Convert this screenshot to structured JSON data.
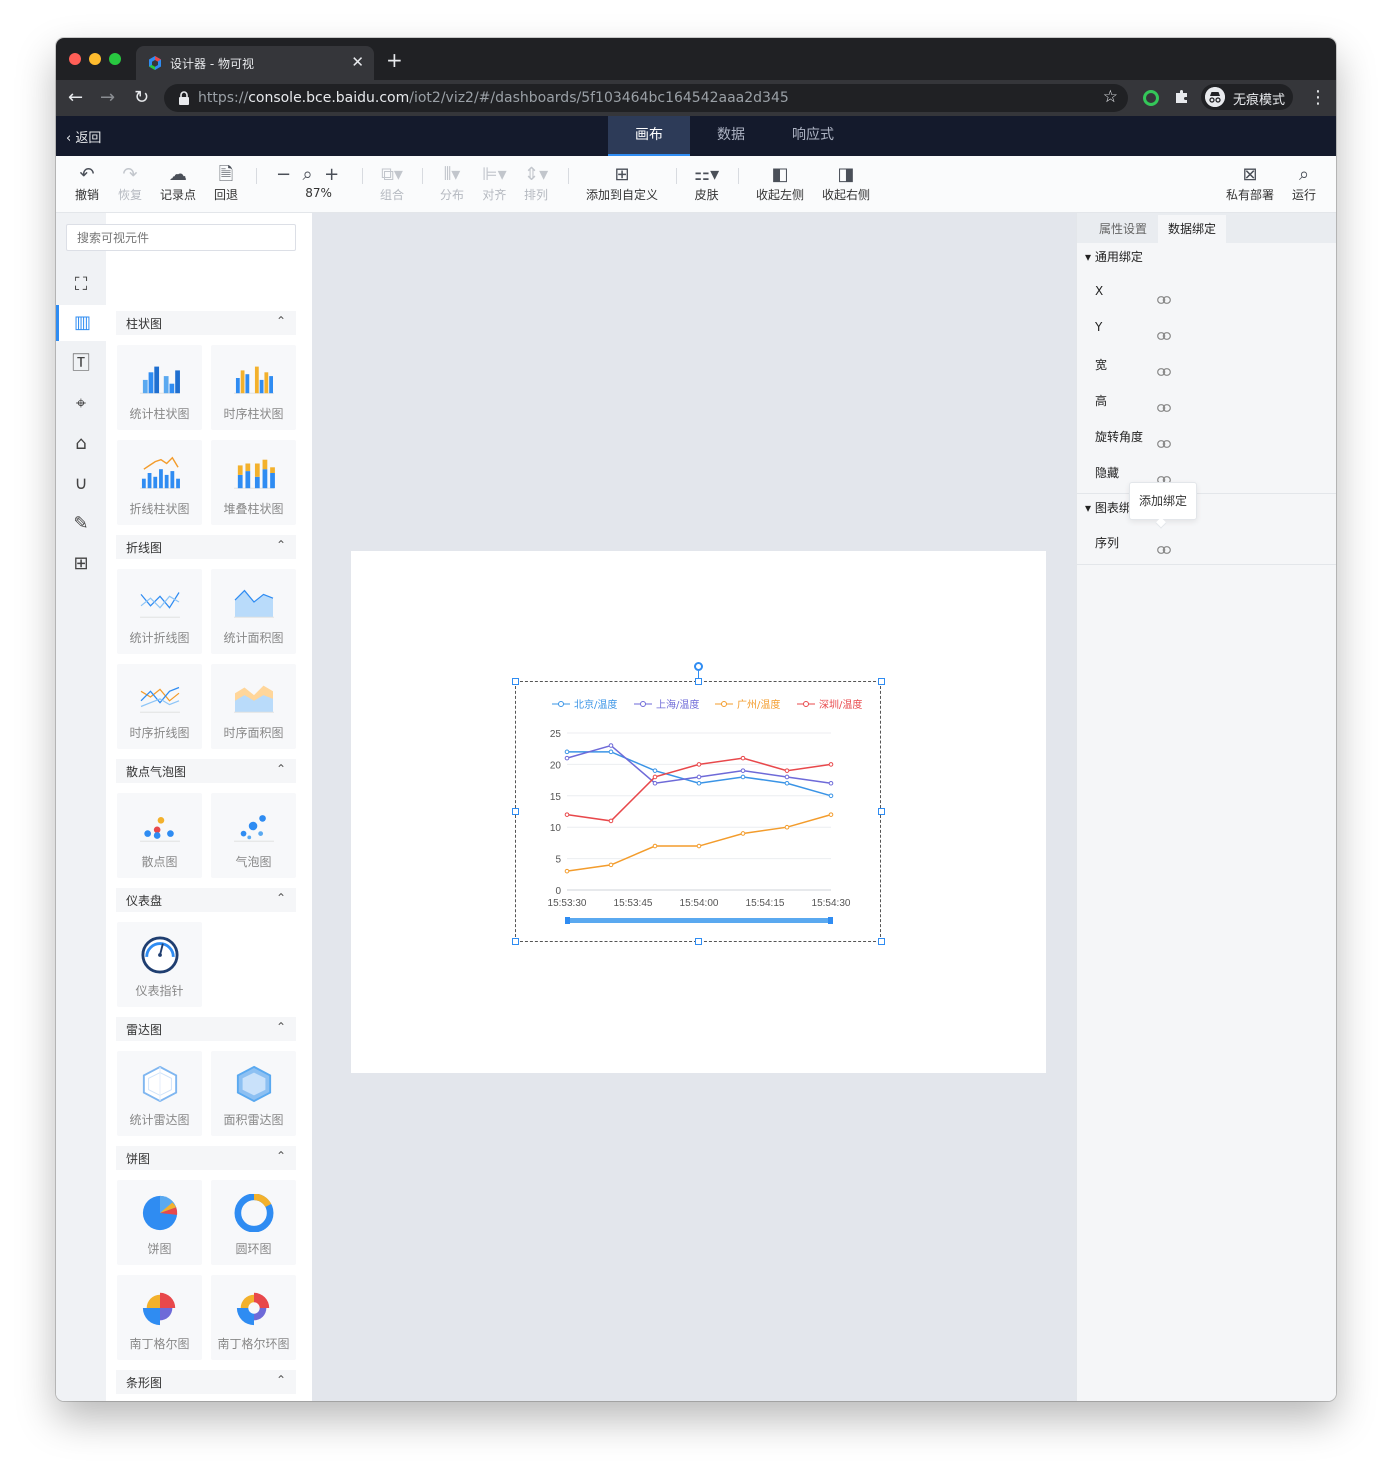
{
  "browser": {
    "tab_title": "设计器 - 物可视",
    "url_scheme": "https://",
    "url_host": "console.bce.baidu.com",
    "url_path": "/iot2/viz2/#/dashboards/5f103464bc164542aaa2d345",
    "incognito_label": "无痕模式",
    "close_glyph": "✕",
    "newtab_glyph": "+",
    "back_glyph": "←",
    "forward_glyph": "→",
    "reload_glyph": "↻",
    "star_glyph": "☆"
  },
  "header": {
    "back_label": "返回",
    "tabs": [
      "画布",
      "数据",
      "响应式"
    ],
    "active_tab": "画布"
  },
  "toolbar": {
    "undo": "撤销",
    "redo": "恢复",
    "record_point": "记录点",
    "revert": "回退",
    "zoom": "87%",
    "group": "组合",
    "distribute": "分布",
    "align": "对齐",
    "arrange": "排列",
    "add_custom": "添加到自定义",
    "skin": "皮肤",
    "collapse_left": "收起左侧",
    "collapse_right": "收起右侧",
    "private_deploy": "私有部署",
    "run": "运行"
  },
  "component_panel": {
    "search_placeholder": "搜索可视元件",
    "sections": [
      {
        "title": "柱状图",
        "items": [
          "统计柱状图",
          "时序柱状图",
          "折线柱状图",
          "堆叠柱状图"
        ]
      },
      {
        "title": "折线图",
        "items": [
          "统计折线图",
          "统计面积图",
          "时序折线图",
          "时序面积图"
        ]
      },
      {
        "title": "散点气泡图",
        "items": [
          "散点图",
          "气泡图"
        ]
      },
      {
        "title": "仪表盘",
        "items": [
          "仪表指针"
        ]
      },
      {
        "title": "雷达图",
        "items": [
          "统计雷达图",
          "面积雷达图"
        ]
      },
      {
        "title": "饼图",
        "items": [
          "饼图",
          "圆环图",
          "南丁格尔图",
          "南丁格尔环图"
        ]
      },
      {
        "title": "条形图",
        "items": []
      }
    ]
  },
  "right_panel": {
    "tabs": [
      "属性设置",
      "数据绑定"
    ],
    "active_tab": "数据绑定",
    "general_group": "通用绑定",
    "general_fields": [
      "X",
      "Y",
      "宽",
      "高",
      "旋转角度",
      "隐藏"
    ],
    "chart_group": "图表绑定",
    "chart_group_visible": "图表绑",
    "chart_fields": [
      "序列"
    ],
    "tooltip": "添加绑定"
  },
  "chart_data": {
    "type": "line",
    "x": [
      "15:53:30",
      "15:53:37.5",
      "15:53:45",
      "15:53:52.5",
      "15:54:00",
      "15:54:07.5",
      "15:54:15",
      "15:54:22.5",
      "15:54:30"
    ],
    "xticks": [
      "15:53:30",
      "15:53:45",
      "15:54:00",
      "15:54:15",
      "15:54:30"
    ],
    "ylim": [
      0,
      25
    ],
    "yticks": [
      0,
      5,
      10,
      15,
      20,
      25
    ],
    "legend_position": "top",
    "grid": true,
    "series": [
      {
        "name": "北京/温度",
        "color": "#3a94e6",
        "values": [
          22,
          22,
          19,
          17,
          18,
          17,
          15
        ]
      },
      {
        "name": "上海/温度",
        "color": "#6e6ad8",
        "values": [
          21,
          23,
          17,
          18,
          19,
          18,
          17
        ]
      },
      {
        "name": "广州/温度",
        "color": "#f39c2c",
        "values": [
          3,
          4,
          7,
          7,
          9,
          10,
          12
        ]
      },
      {
        "name": "深圳/温度",
        "color": "#e8484b",
        "values": [
          12,
          11,
          18,
          20,
          21,
          19,
          20
        ]
      }
    ],
    "x_points": [
      "15:53:30",
      "15:53:40",
      "15:53:50",
      "15:54:00",
      "15:54:10",
      "15:54:20",
      "15:54:30"
    ]
  }
}
